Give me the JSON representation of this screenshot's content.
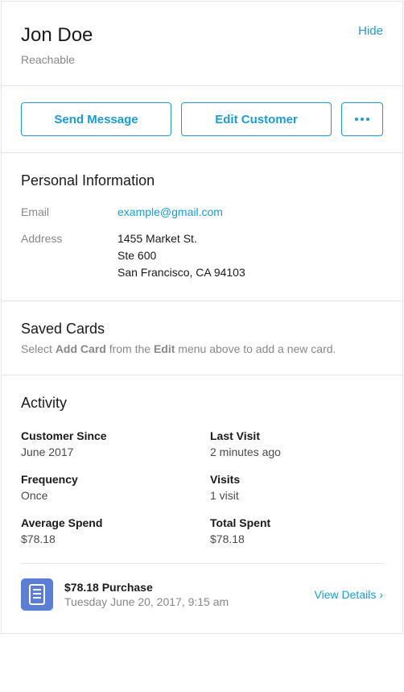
{
  "header": {
    "name": "Jon Doe",
    "status": "Reachable",
    "hide": "Hide"
  },
  "buttons": {
    "sendMessage": "Send Message",
    "editCustomer": "Edit Customer"
  },
  "personalInfo": {
    "title": "Personal Information",
    "emailLabel": "Email",
    "email": "example@gmail.com",
    "addressLabel": "Address",
    "addressLine1": "1455 Market St.",
    "addressLine2": "Ste 600",
    "addressLine3": "San Francisco, CA 94103"
  },
  "savedCards": {
    "title": "Saved Cards",
    "sub_pre": "Select ",
    "sub_b1": "Add Card",
    "sub_mid": " from the ",
    "sub_b2": "Edit",
    "sub_post": " menu above to add a new card."
  },
  "activity": {
    "title": "Activity",
    "stats": {
      "customerSinceLabel": "Customer Since",
      "customerSince": "June 2017",
      "lastVisitLabel": "Last Visit",
      "lastVisit": "2 minutes ago",
      "frequencyLabel": "Frequency",
      "frequency": "Once",
      "visitsLabel": "Visits",
      "visits": "1 visit",
      "averageSpendLabel": "Average Spend",
      "averageSpend": "$78.18",
      "totalSpentLabel": "Total Spent",
      "totalSpent": "$78.18"
    },
    "purchase": {
      "title": "$78.18 Purchase",
      "date": "Tuesday June 20, 2017, 9:15 am",
      "viewDetails": "View Details"
    }
  }
}
